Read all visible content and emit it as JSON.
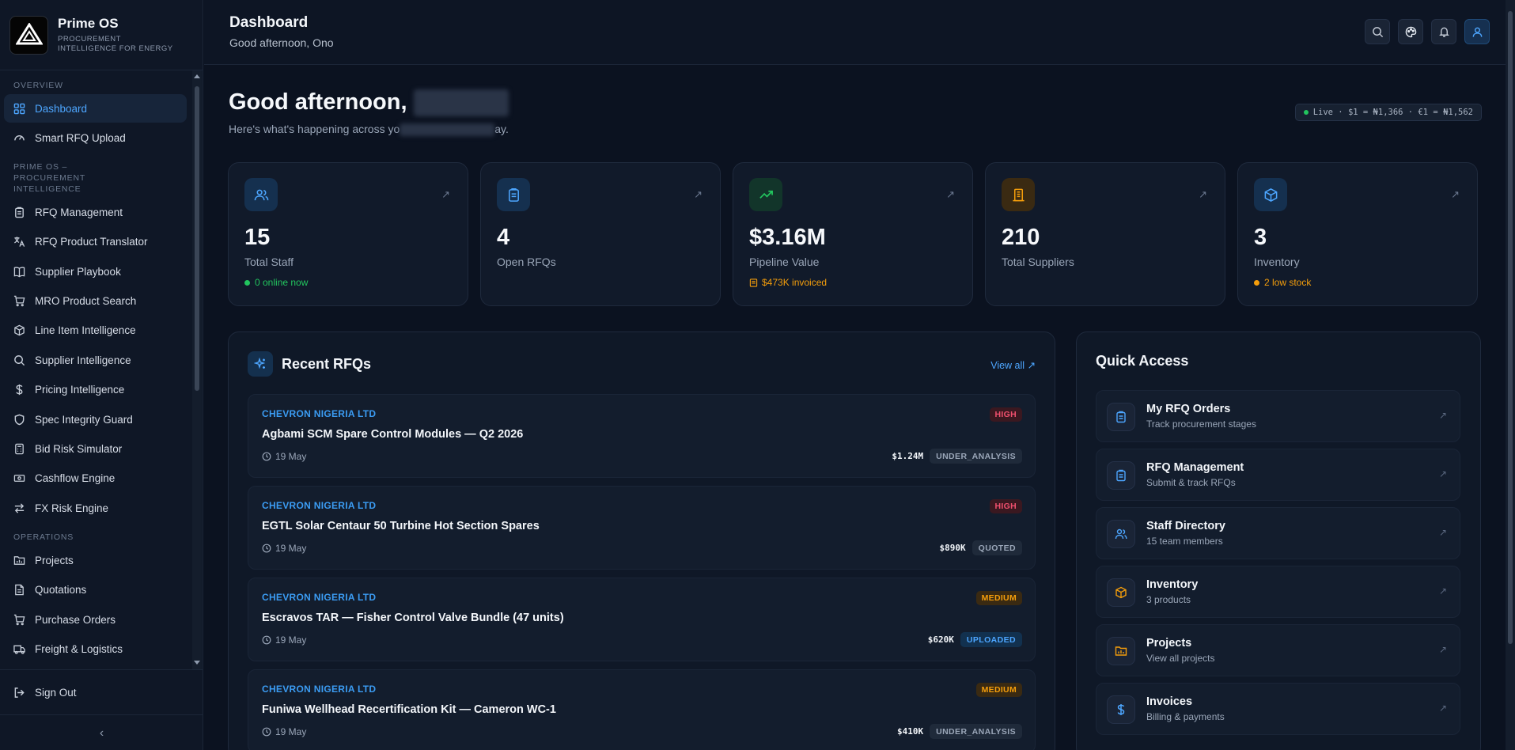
{
  "brand": {
    "name": "Prime OS",
    "tagline": "PROCUREMENT INTELLIGENCE FOR ENERGY"
  },
  "sidebar": {
    "sections": [
      {
        "label": "OVERVIEW",
        "items": [
          {
            "label": "Dashboard",
            "icon": "grid-icon",
            "active": true
          },
          {
            "label": "Smart RFQ Upload",
            "icon": "gauge-icon"
          }
        ]
      },
      {
        "label": "PRIME OS – PROCUREMENT INTELLIGENCE",
        "items": [
          {
            "label": "RFQ Management",
            "icon": "clipboard-icon"
          },
          {
            "label": "RFQ Product Translator",
            "icon": "translate-icon"
          },
          {
            "label": "Supplier Playbook",
            "icon": "book-icon"
          },
          {
            "label": "MRO Product Search",
            "icon": "cart-icon"
          },
          {
            "label": "Line Item Intelligence",
            "icon": "box-icon"
          },
          {
            "label": "Supplier Intelligence",
            "icon": "search-icon"
          },
          {
            "label": "Pricing Intelligence",
            "icon": "dollar-icon"
          },
          {
            "label": "Spec Integrity Guard",
            "icon": "shield-icon"
          },
          {
            "label": "Bid Risk Simulator",
            "icon": "calculator-icon"
          },
          {
            "label": "Cashflow Engine",
            "icon": "banknote-icon"
          },
          {
            "label": "FX Risk Engine",
            "icon": "exchange-icon"
          }
        ]
      },
      {
        "label": "OPERATIONS",
        "items": [
          {
            "label": "Projects",
            "icon": "folder-icon"
          },
          {
            "label": "Quotations",
            "icon": "document-icon"
          },
          {
            "label": "Purchase Orders",
            "icon": "cart-icon"
          },
          {
            "label": "Freight & Logistics",
            "icon": "truck-icon"
          }
        ]
      }
    ],
    "sign_out": "Sign Out",
    "collapse": "‹"
  },
  "topbar": {
    "title": "Dashboard",
    "subtitle": "Good afternoon, Ono"
  },
  "greeting": {
    "title": "Good afternoon,",
    "sub_before": "Here's what's happening across yo",
    "sub_after": "ay."
  },
  "live_rates": "Live · $1 = ₦1,366 · €1 = ₦1,562",
  "stats": [
    {
      "value": "15",
      "label": "Total Staff",
      "note": "0 online now",
      "note_color": "#22c55e",
      "icon": "users-icon",
      "icon_color": "#4da6ff",
      "icon_bg": "#15304f"
    },
    {
      "value": "4",
      "label": "Open RFQs",
      "note": "",
      "icon": "clipboard-icon",
      "icon_color": "#4da6ff",
      "icon_bg": "#15304f"
    },
    {
      "value": "$3.16M",
      "label": "Pipeline Value",
      "note": "$473K invoiced",
      "note_color": "#f59e0b",
      "icon": "trending-up-icon",
      "icon_color": "#22c55e",
      "icon_bg": "#12352a"
    },
    {
      "value": "210",
      "label": "Total Suppliers",
      "note": "",
      "icon": "building-icon",
      "icon_color": "#f59e0b",
      "icon_bg": "#3a2a12"
    },
    {
      "value": "3",
      "label": "Inventory",
      "note": "2 low stock",
      "note_color": "#f59e0b",
      "icon": "package-icon",
      "icon_color": "#4da6ff",
      "icon_bg": "#15304f"
    }
  ],
  "recent": {
    "title": "Recent RFQs",
    "view_all": "View all ↗",
    "items": [
      {
        "client": "CHEVRON NIGERIA LTD",
        "title": "Agbami SCM Spare Control Modules — Q2 2026",
        "date": "19 May",
        "priority": "HIGH",
        "amount": "$1.24M",
        "status": "UNDER_ANALYSIS"
      },
      {
        "client": "CHEVRON NIGERIA LTD",
        "title": "EGTL Solar Centaur 50 Turbine Hot Section Spares",
        "date": "19 May",
        "priority": "HIGH",
        "amount": "$890K",
        "status": "QUOTED"
      },
      {
        "client": "CHEVRON NIGERIA LTD",
        "title": "Escravos TAR — Fisher Control Valve Bundle (47 units)",
        "date": "19 May",
        "priority": "MEDIUM",
        "amount": "$620K",
        "status": "UPLOADED"
      },
      {
        "client": "CHEVRON NIGERIA LTD",
        "title": "Funiwa Wellhead Recertification Kit — Cameron WC-1",
        "date": "19 May",
        "priority": "MEDIUM",
        "amount": "$410K",
        "status": "UNDER_ANALYSIS"
      }
    ]
  },
  "quick_access": {
    "title": "Quick Access",
    "items": [
      {
        "title": "My RFQ Orders",
        "sub": "Track procurement stages",
        "icon": "clipboard-icon",
        "icon_color": "#4da6ff"
      },
      {
        "title": "RFQ Management",
        "sub": "Submit & track RFQs",
        "icon": "clipboard-icon",
        "icon_color": "#4da6ff"
      },
      {
        "title": "Staff Directory",
        "sub": "15 team members",
        "icon": "users-icon",
        "icon_color": "#4da6ff"
      },
      {
        "title": "Inventory",
        "sub": "3 products",
        "icon": "package-icon",
        "icon_color": "#f59e0b"
      },
      {
        "title": "Projects",
        "sub": "View all projects",
        "icon": "folder-icon",
        "icon_color": "#f59e0b"
      },
      {
        "title": "Invoices",
        "sub": "Billing & payments",
        "icon": "dollar-icon",
        "icon_color": "#4da6ff"
      }
    ]
  },
  "colors": {
    "accent": "#4da6ff",
    "priority_high_bg": "#3a1820",
    "priority_high_fg": "#f0506e",
    "priority_medium_bg": "#3a2a12",
    "priority_medium_fg": "#f59e0b",
    "status_default_bg": "#1f2a3a",
    "status_default_fg": "#9aa6b8",
    "status_uploaded_bg": "#12314f",
    "status_uploaded_fg": "#4da6ff"
  }
}
